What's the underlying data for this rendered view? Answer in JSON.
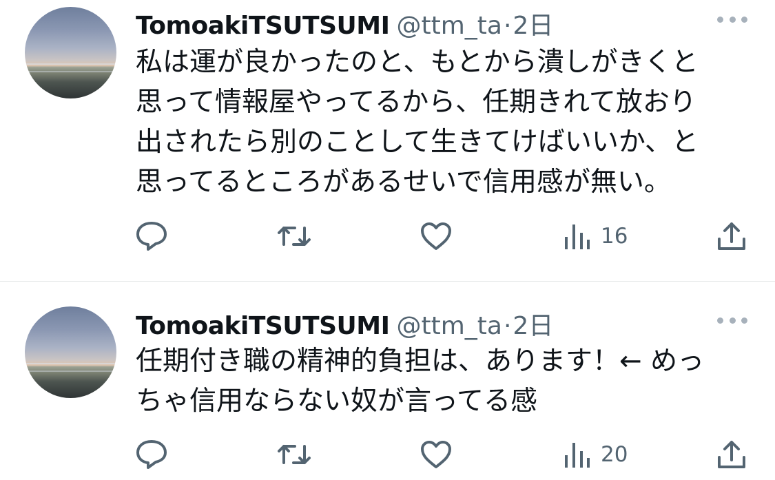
{
  "tweets": [
    {
      "author_name": "TomoakiTSUTSUMI",
      "handle": "@ttm_ta",
      "separator": "·",
      "time": "2日",
      "text": "私は運が良かったのと、もとから潰しがきくと\n思って情報屋やってるから、任期きれて放おり\n出されたら別のことして生きてけばいいか、と\n思ってるところがあるせいで信用感が無い。",
      "actions": {
        "reply_icon": "reply-icon",
        "retweet_icon": "retweet-icon",
        "like_icon": "like-icon",
        "views_icon": "views-icon",
        "views": "16",
        "share_icon": "share-icon"
      }
    },
    {
      "author_name": "TomoakiTSUTSUMI",
      "handle": "@ttm_ta",
      "separator": "·",
      "time": "2日",
      "text": "任期付き職の精神的負担は、あります！← めっ\nちゃ信用ならない奴が言ってる感",
      "actions": {
        "reply_icon": "reply-icon",
        "retweet_icon": "retweet-icon",
        "like_icon": "like-icon",
        "views_icon": "views-icon",
        "views": "20",
        "share_icon": "share-icon"
      }
    }
  ],
  "colors": {
    "text": "#0f1419",
    "secondary": "#536471",
    "divider": "#e7e9ea",
    "icon": "#536471"
  }
}
